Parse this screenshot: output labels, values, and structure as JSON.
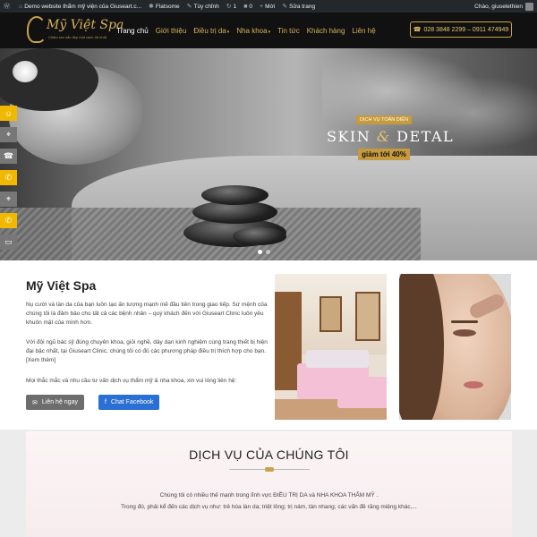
{
  "adminbar": {
    "site_title": "Demo website thẩm mỹ viện của Giuseart.c...",
    "theme": "Flatsome",
    "customize": "Tùy chỉnh",
    "updates": "1",
    "comments": "0",
    "new": "Mới",
    "edit": "Sửa trang",
    "greeting": "Chào, giuselethien"
  },
  "header": {
    "logo_name": "Mỹ Việt Spa",
    "logo_tagline": "Chăm sóc sắc đẹp một cách tốt nhất",
    "phone": "028 3848 2299 – 0911 474949",
    "nav": [
      {
        "label": "Trang chủ",
        "active": true,
        "has_caret": false
      },
      {
        "label": "Giới thiệu",
        "active": false,
        "has_caret": false
      },
      {
        "label": "Điều trị da",
        "active": false,
        "has_caret": true
      },
      {
        "label": "Nha khoa",
        "active": false,
        "has_caret": true
      },
      {
        "label": "Tin tức",
        "active": false,
        "has_caret": false
      },
      {
        "label": "Khách hàng",
        "active": false,
        "has_caret": false
      },
      {
        "label": "Liên hệ",
        "active": false,
        "has_caret": false
      }
    ]
  },
  "hero": {
    "badge": "DỊCH VỤ TOÀN DIỆN",
    "headline_left": "SKIN",
    "headline_amp": "&",
    "headline_right": "DETAL",
    "sale": "giảm tới 40%",
    "slide_count": 2,
    "active_slide": 1
  },
  "about": {
    "title": "Mỹ Việt Spa",
    "paragraph1": "Nụ cười và làn da của bạn luôn tạo ấn tượng mạnh mẽ đầu tiên trong giao tiếp. Sứ mệnh của chúng tôi là đảm bảo cho tất cả các bệnh nhân – quý khách đến với Giuseart Clinic luôn yêu khuôn mặt của mình hơn.",
    "paragraph2": "Với đội ngũ bác sỹ đúng chuyên khoa, giỏi nghề, dày dạn kinh nghiệm cùng trang thiết bị hiện đại bậc nhất, tại Giuseart Clinic, chúng tôi có đủ các phương pháp điều trị thích hợp cho bạn. [Xem thêm]",
    "paragraph3": "Mọi thắc mắc và nhu cầu tư vấn dịch vụ thẩm mỹ & nha khoa, xin vui lòng liên hệ:",
    "contact_button": "Liên hệ ngay",
    "facebook_button": "Chat Facebook"
  },
  "services": {
    "title": "DỊCH VỤ CỦA CHÚNG TÔI",
    "line1": "Chúng tôi có nhiều thế mạnh trong lĩnh vực  ĐIỀU TRỊ DA  và  NHA KHOA THẨM MỸ .",
    "line2": "Trong đó, phải kể đến các dịch vụ như: trẻ hóa làn da; triệt lông; trị nám, tàn nhang; các vấn đề răng miệng khác,..."
  },
  "colors": {
    "gold": "#c9a24a",
    "header_bg": "#111111",
    "facebook": "#2a6fd3",
    "side_contact": "#f0b800"
  }
}
